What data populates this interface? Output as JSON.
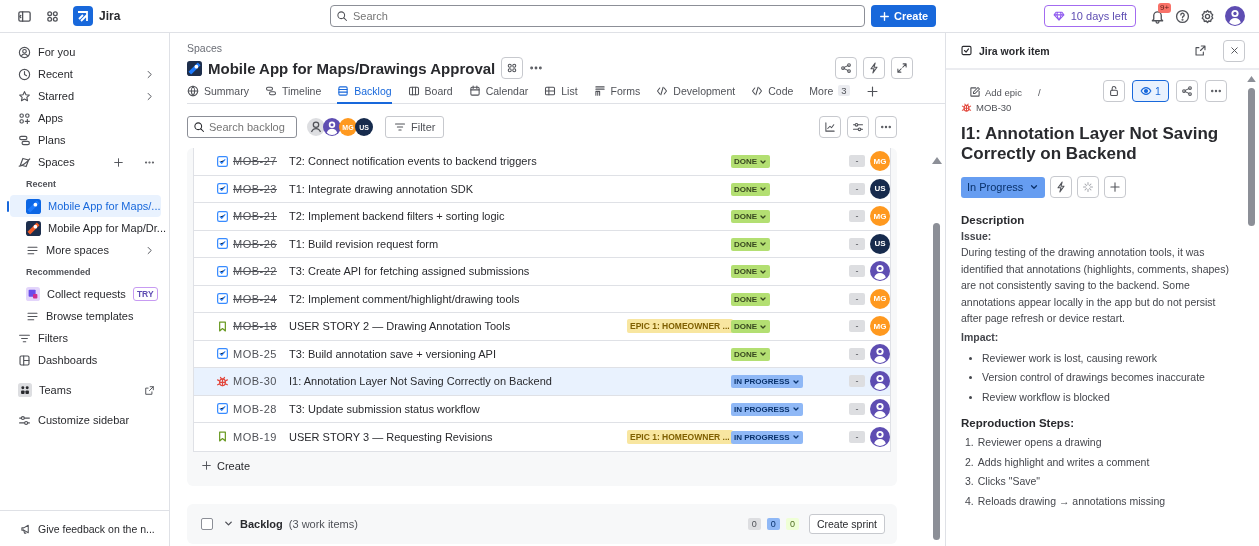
{
  "top_bar": {
    "product": "Jira",
    "search": {
      "placeholder": "Search"
    },
    "create_button": "Create",
    "trial": "10 days left",
    "notifications_badge": "9+"
  },
  "sidebar": {
    "items": [
      {
        "kind": "nav",
        "label": "For you",
        "chevron": false
      },
      {
        "kind": "nav",
        "label": "Recent",
        "chevron": true
      },
      {
        "kind": "nav",
        "label": "Starred",
        "chevron": true
      },
      {
        "kind": "nav",
        "label": "Apps",
        "chevron": false
      },
      {
        "kind": "nav",
        "label": "Plans",
        "chevron": false
      },
      {
        "kind": "section",
        "label": "Spaces"
      },
      {
        "kind": "heading",
        "label": "Recent"
      },
      {
        "kind": "space",
        "label": "Mobile App for Maps/...",
        "selected": true
      },
      {
        "kind": "space",
        "label": "Mobile App for Map/Dr...",
        "selected": false
      },
      {
        "kind": "sub",
        "label": "More spaces",
        "chevron": true
      },
      {
        "kind": "heading",
        "label": "Recommended"
      },
      {
        "kind": "sub",
        "label": "Collect requests",
        "badge": "TRY",
        "chevron": false
      },
      {
        "kind": "sub",
        "label": "Browse templates",
        "chevron": false
      },
      {
        "kind": "nav",
        "label": "Filters",
        "chevron": false
      },
      {
        "kind": "nav",
        "label": "Dashboards",
        "chevron": false
      },
      {
        "kind": "external",
        "label": "Teams"
      },
      {
        "kind": "nav",
        "label": "Customize sidebar",
        "chevron": false
      }
    ],
    "feedback": "Give feedback on the n..."
  },
  "space": {
    "breadcrumb": "Spaces",
    "title": "Mobile App for Maps/Drawings Approval",
    "tabs": [
      {
        "label": "Summary",
        "selected": false
      },
      {
        "label": "Timeline",
        "selected": false
      },
      {
        "label": "Backlog",
        "selected": true
      },
      {
        "label": "Board",
        "selected": false
      },
      {
        "label": "Calendar",
        "selected": false
      },
      {
        "label": "List",
        "selected": false
      },
      {
        "label": "Forms",
        "selected": false
      },
      {
        "label": "Development",
        "selected": false
      },
      {
        "label": "Code",
        "selected": false
      },
      {
        "label": "More",
        "count": "3",
        "selected": false
      }
    ],
    "search": {
      "placeholder": "Search backlog"
    },
    "avatars": [
      {
        "kind": "unassigned"
      },
      {
        "kind": "user"
      },
      {
        "kind": "initials",
        "initials": "MG",
        "color": "#ff991f"
      },
      {
        "kind": "initials",
        "initials": "US",
        "color": "#172b4d"
      }
    ],
    "filter_button": "Filter"
  },
  "sprint": {
    "rows": [
      {
        "kind": "task",
        "key": "MOB-27",
        "resolved": true,
        "summary": "T2: Connect notification events to backend triggers",
        "status": {
          "label": "DONE",
          "kind": "done"
        },
        "estimate": "-",
        "assignee": {
          "kind": "initials",
          "initials": "MG",
          "color": "#ff991f"
        },
        "selected": false
      },
      {
        "kind": "task",
        "key": "MOB-23",
        "resolved": true,
        "summary": "T1: Integrate drawing annotation SDK",
        "status": {
          "label": "DONE",
          "kind": "done"
        },
        "estimate": "-",
        "assignee": {
          "kind": "initials",
          "initials": "US",
          "color": "#172b4d"
        },
        "selected": false
      },
      {
        "kind": "task",
        "key": "MOB-21",
        "resolved": true,
        "summary": "T2: Implement backend filters + sorting logic",
        "status": {
          "label": "DONE",
          "kind": "done"
        },
        "estimate": "-",
        "assignee": {
          "kind": "initials",
          "initials": "MG",
          "color": "#ff991f"
        },
        "selected": false
      },
      {
        "kind": "task",
        "key": "MOB-26",
        "resolved": true,
        "summary": "T1: Build revision request form",
        "status": {
          "label": "DONE",
          "kind": "done"
        },
        "estimate": "-",
        "assignee": {
          "kind": "initials",
          "initials": "US",
          "color": "#172b4d"
        },
        "selected": false
      },
      {
        "kind": "task",
        "key": "MOB-22",
        "resolved": true,
        "summary": "T3: Create API for fetching assigned submissions",
        "status": {
          "label": "DONE",
          "kind": "done"
        },
        "estimate": "-",
        "assignee": {
          "kind": "user"
        },
        "selected": false
      },
      {
        "kind": "task",
        "key": "MOB-24",
        "resolved": true,
        "summary": "T2: Implement comment/highlight/drawing tools",
        "status": {
          "label": "DONE",
          "kind": "done"
        },
        "estimate": "-",
        "assignee": {
          "kind": "initials",
          "initials": "MG",
          "color": "#ff991f"
        },
        "selected": false
      },
      {
        "kind": "story",
        "key": "MOB-18",
        "resolved": true,
        "summary": "USER STORY 2 — Drawing Annotation Tools",
        "epic": "EPIC 1: HOMEOWNER ...",
        "status": {
          "label": "DONE",
          "kind": "done"
        },
        "estimate": "-",
        "assignee": {
          "kind": "initials",
          "initials": "MG",
          "color": "#ff991f"
        },
        "selected": false
      },
      {
        "kind": "task",
        "key": "MOB-25",
        "resolved": false,
        "summary": "T3: Build annotation save + versioning API",
        "status": {
          "label": "DONE",
          "kind": "done"
        },
        "estimate": "-",
        "assignee": {
          "kind": "user"
        },
        "selected": false
      },
      {
        "kind": "bug",
        "key": "MOB-30",
        "resolved": false,
        "summary": "I1: Annotation Layer Not Saving Correctly on Backend",
        "status": {
          "label": "IN PROGRESS",
          "kind": "in_progress"
        },
        "estimate": "-",
        "assignee": {
          "kind": "user"
        },
        "selected": true
      },
      {
        "kind": "task",
        "key": "MOB-28",
        "resolved": false,
        "summary": "T3: Update submission status workflow",
        "status": {
          "label": "IN PROGRESS",
          "kind": "in_progress"
        },
        "estimate": "-",
        "assignee": {
          "kind": "user"
        },
        "selected": false
      },
      {
        "kind": "story",
        "key": "MOB-19",
        "resolved": false,
        "summary": "USER STORY 3 — Requesting Revisions",
        "epic": "EPIC 1: HOMEOWNER ...",
        "status": {
          "label": "IN PROGRESS",
          "kind": "in_progress"
        },
        "estimate": "-",
        "assignee": {
          "kind": "user"
        },
        "selected": false
      }
    ],
    "create": "Create"
  },
  "backlog": {
    "title": "Backlog",
    "count": "(3 work items)",
    "checked": false,
    "expanded": true,
    "counts": [
      "0",
      "0",
      "0"
    ],
    "button": "Create sprint"
  },
  "work_item": {
    "header": "Jira work item",
    "add_epic": "Add epic",
    "separator": "/",
    "key": "MOB-30",
    "watchers": "1",
    "watching": true,
    "title": "I1: Annotation Layer Not Saving Correctly on Backend",
    "status": "In Progress",
    "description_heading": "Description",
    "blocks": [
      {
        "kind": "label",
        "text": "Issue:"
      },
      {
        "kind": "paragraph",
        "text": "During testing of the drawing annotation tools, it was identified that annotations (highlights, comments, shapes) are not consistently saving to the backend. Some annotations appear locally in the app but do not persist after page refresh or device restart."
      },
      {
        "kind": "label",
        "text": "Impact:"
      },
      {
        "kind": "bullets",
        "items": [
          "Reviewer work is lost, causing rework",
          "Version control of drawings becomes inaccurate",
          "Review workflow is blocked"
        ]
      },
      {
        "kind": "heading",
        "text": "Reproduction Steps:"
      },
      {
        "kind": "numbered",
        "items": [
          {
            "number": "1.",
            "text": "Reviewer opens a drawing"
          },
          {
            "number": "2.",
            "text": "Adds highlight and writes a comment"
          },
          {
            "number": "3.",
            "text": "Clicks \"Save\""
          },
          {
            "number": "4.",
            "text": "Reloads drawing → annotations missing"
          }
        ]
      }
    ]
  }
}
